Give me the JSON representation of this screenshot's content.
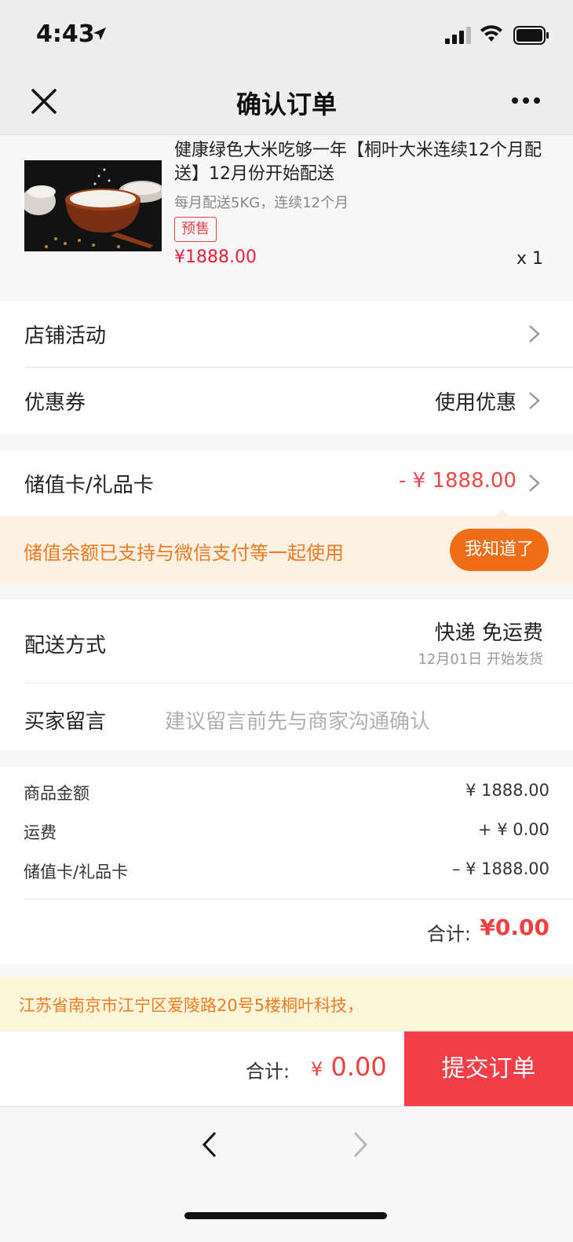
{
  "status_bar": {
    "time": "4:43"
  },
  "nav": {
    "title": "确认订单"
  },
  "product": {
    "title": "健康绿色大米吃够一年【桐叶大米连续12个月配送】12月份开始配送",
    "subtitle": "每月配送5KG，连续12个月",
    "tag": "预售",
    "price": "¥1888.00",
    "quantity": "x 1"
  },
  "promotions": {
    "shop_activity_label": "店铺活动",
    "coupon_label": "优惠券",
    "coupon_value": "使用优惠"
  },
  "stored_card": {
    "label": "储值卡/礼品卡",
    "value": "- ¥ 1888.00"
  },
  "tip": {
    "text": "储值余额已支持与微信支付等一起使用",
    "button": "我知道了"
  },
  "delivery": {
    "label": "配送方式",
    "method": "快递 免运费",
    "ship_date": "12月01日 开始发货"
  },
  "message": {
    "label": "买家留言",
    "placeholder": "建议留言前先与商家沟通确认"
  },
  "summary": {
    "rows": [
      {
        "label": "商品金额",
        "value": "¥ 1888.00"
      },
      {
        "label": "运费",
        "value": "+ ¥ 0.00"
      },
      {
        "label": "储值卡/礼品卡",
        "value": "– ¥ 1888.00"
      }
    ],
    "total_label": "合计:",
    "total_value": "¥0.00"
  },
  "address": {
    "text": "江苏省南京市江宁区爱陵路20号5楼桐叶科技，"
  },
  "bottom_bar": {
    "total_label": "合计:",
    "currency": "¥",
    "total_amount": "0.00",
    "submit": "提交订单"
  },
  "colors": {
    "price_red": "#e5213a",
    "submit_red": "#f23f47",
    "tip_orange": "#f06d17",
    "tip_bg": "#fdf1e4",
    "address_bg": "#fdf6d8"
  }
}
